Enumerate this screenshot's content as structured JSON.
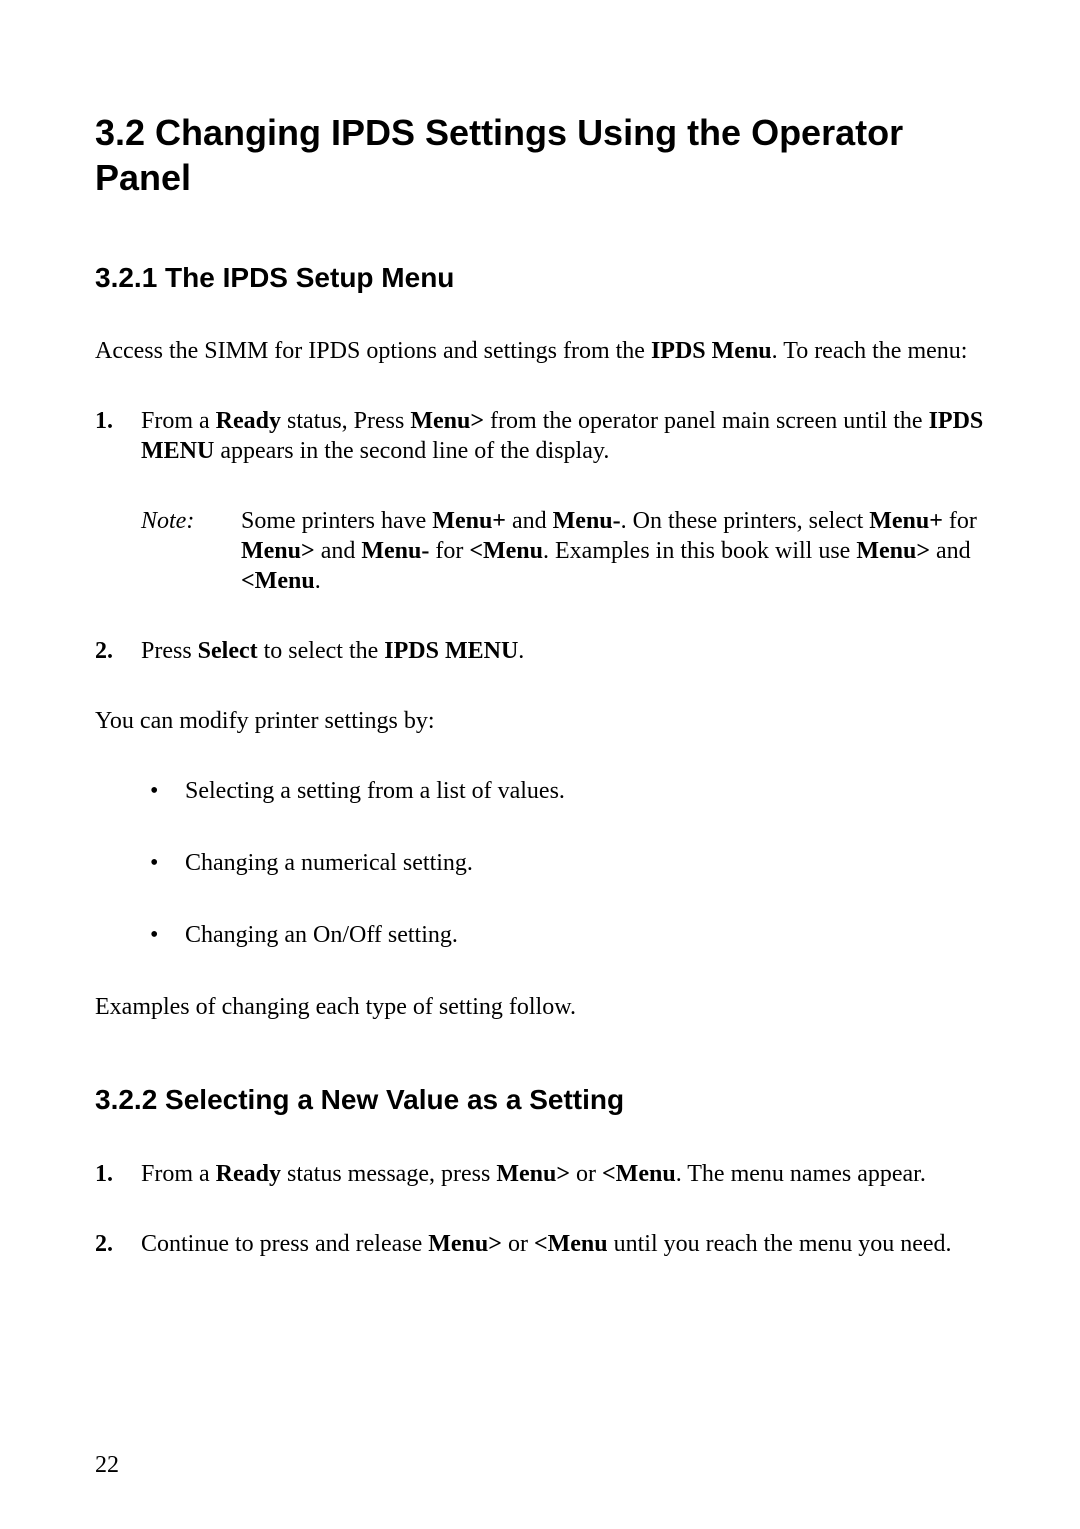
{
  "heading1": "3.2 Changing IPDS Settings Using the Operator Panel",
  "heading2a": "3.2.1 The IPDS Setup Menu",
  "intro_pre": "Access the SIMM for IPDS options and settings from the ",
  "intro_bold": "IPDS Menu",
  "intro_post": ". To reach the menu:",
  "ol1": {
    "item1": {
      "marker": "1.",
      "p1": "From a ",
      "b1": "Ready",
      "p2": " status, Press ",
      "b2": "Menu>",
      "p3": " from the operator panel main screen until the ",
      "b3": "IPDS MENU",
      "p4": " appears in the second line of the display."
    },
    "note": {
      "label": "Note:",
      "p1": "Some printers have ",
      "b1": "Menu+",
      "p2": " and ",
      "b2": "Menu-",
      "p3": ". On these printers, select ",
      "b3": "Menu+",
      "p4": " for ",
      "b4": "Menu>",
      "p5": " and ",
      "b5": "Menu-",
      "p6": " for ",
      "b6": "<Menu",
      "p7": ". Examples in this book will use ",
      "b7": "Menu>",
      "p8": " and ",
      "b8": "<Menu",
      "p9": "."
    },
    "item2": {
      "marker": "2.",
      "p1": "Press ",
      "b1": "Select",
      "p2": " to select the ",
      "b2": "IPDS MENU",
      "p3": "."
    }
  },
  "modify_intro": "You can modify printer settings by:",
  "bullets": {
    "b1": "Selecting a setting from a list of values.",
    "b2": "Changing a numerical setting.",
    "b3": "Changing an On/Off setting."
  },
  "examples_follow": "Examples of changing each type of setting follow.",
  "heading2b": "3.2.2 Selecting a New Value as a Setting",
  "ol2": {
    "item1": {
      "marker": "1.",
      "p1": "From a ",
      "b1": "Ready",
      "p2": " status message, press ",
      "b2": "Menu>",
      "p3": " or ",
      "b3": "<Menu",
      "p4": ". The menu names appear."
    },
    "item2": {
      "marker": "2.",
      "p1": "Continue to press and release ",
      "b1": "Menu>",
      "p2": " or ",
      "b2": "<Menu",
      "p3": " until you reach the menu you need."
    }
  },
  "page_number": "22",
  "bullet_char": "•"
}
